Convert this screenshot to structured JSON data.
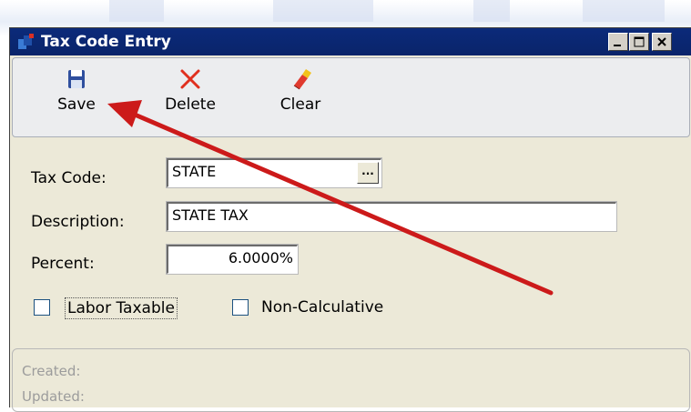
{
  "window": {
    "title": "Tax Code Entry",
    "controls": [
      "minimize",
      "maximize",
      "close"
    ]
  },
  "toolbar": {
    "save_label": "Save",
    "delete_label": "Delete",
    "clear_label": "Clear"
  },
  "form": {
    "tax_code_label": "Tax Code:",
    "tax_code_value": "STATE",
    "lookup_label": "...",
    "description_label": "Description:",
    "description_value": "STATE TAX",
    "percent_label": "Percent:",
    "percent_value": "6.0000%",
    "labor_taxable_label": "Labor Taxable",
    "labor_taxable_checked": false,
    "non_calculative_label": "Non-Calculative",
    "non_calculative_checked": false
  },
  "audit": {
    "created_label": "Created:",
    "updated_label": "Updated:"
  },
  "annotation": {
    "arrow_color": "#cc1a1a",
    "points_to": "save-button"
  },
  "colors": {
    "titlebar": "#0a246a",
    "window_bg": "#ece9d8",
    "toolbar_bg": "#ecedef"
  }
}
